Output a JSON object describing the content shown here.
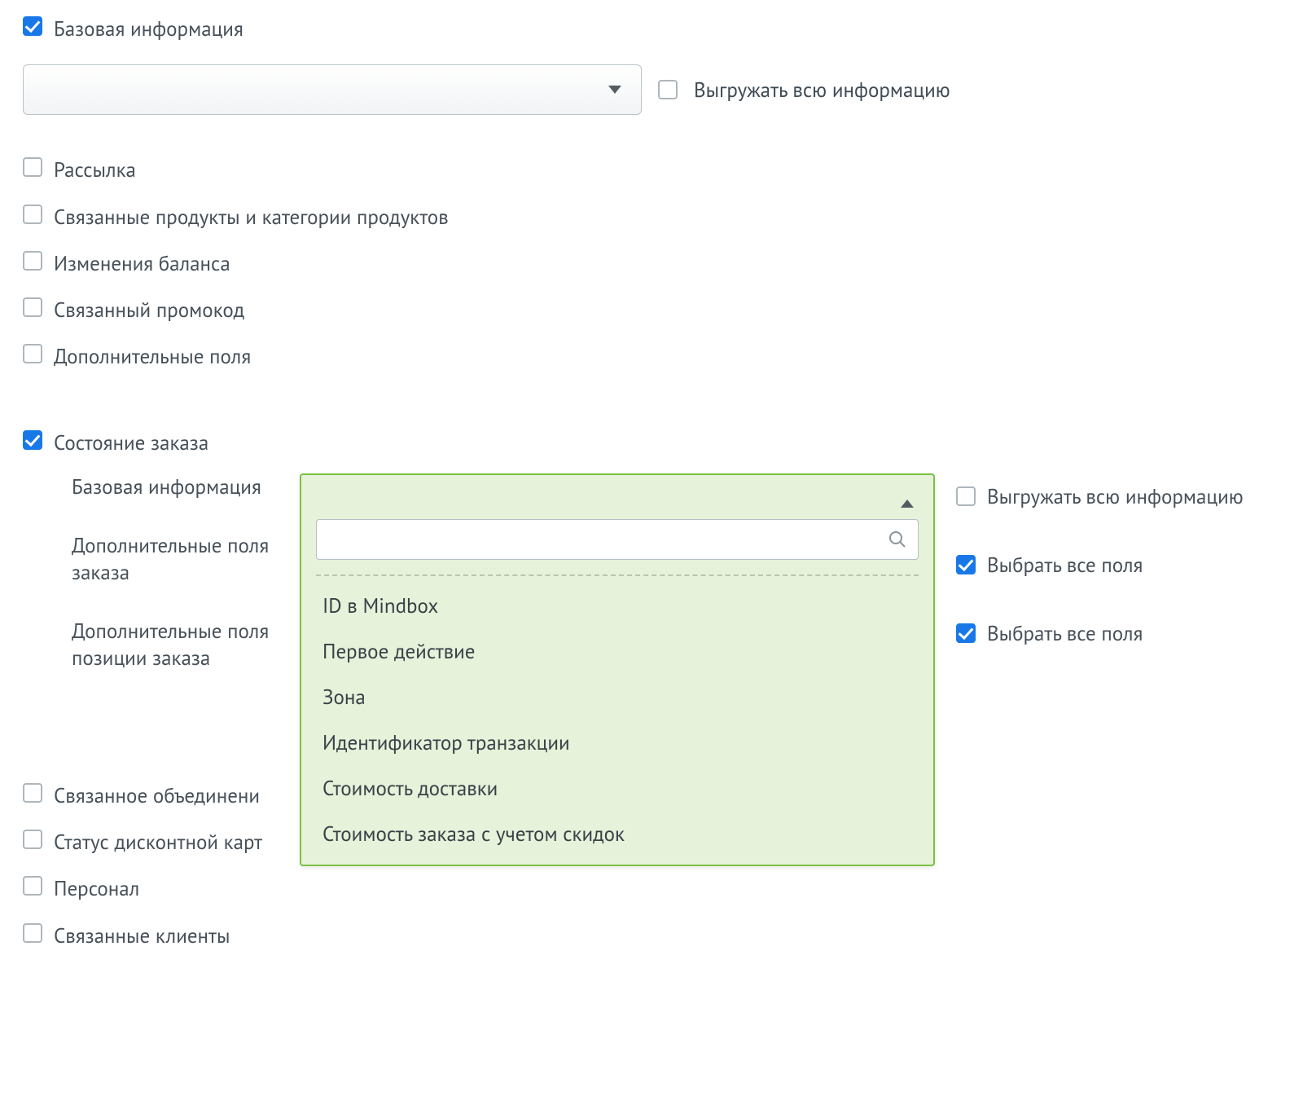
{
  "top": {
    "basic_info": "Базовая информация",
    "export_all": "Выгружать всю информацию"
  },
  "list1": {
    "mailing": "Рассылка",
    "related_products": "Связанные продукты и категории продуктов",
    "balance_changes": "Изменения баланса",
    "related_promocode": "Связанный промокод",
    "additional_fields": "Дополнительные поля"
  },
  "order_state": {
    "title": "Состояние заказа",
    "sub": {
      "basic_info": "Базовая информация",
      "order_extra_fields": "Дополнительные поля заказа",
      "order_line_extra_fields": "Дополнительные поля позиции заказа"
    }
  },
  "right": {
    "export_all": "Выгружать всю информацию",
    "select_all_1": "Выбрать все поля",
    "select_all_2": "Выбрать все поля"
  },
  "popup": {
    "options": {
      "o1": "ID в Mindbox",
      "o2": "Первое действие",
      "o3": "Зона",
      "o4": "Идентификатор транзакции",
      "o5": "Стоимость доставки",
      "o6": "Стоимость заказа с учетом скидок"
    }
  },
  "tail": {
    "related_association": "Связанное объединени",
    "discount_card_status": "Статус дисконтной карт",
    "personnel": "Персонал",
    "related_clients": "Связанные клиенты"
  }
}
